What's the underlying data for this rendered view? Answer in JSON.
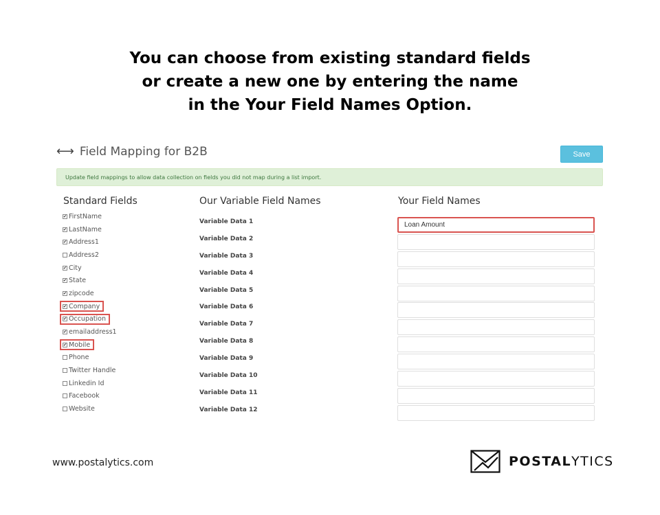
{
  "headline": {
    "line1": "You can choose from existing standard fields",
    "line2": "or create a new one by entering the name",
    "line3": "in the Your Field Names Option."
  },
  "panel": {
    "title": "Field Mapping for B2B",
    "save_label": "Save",
    "alert_text": "Update field mappings to allow data collection on fields you did not map during a list import."
  },
  "columns": {
    "standard": "Standard Fields",
    "variable": "Our Variable Field Names",
    "yours": "Your Field Names"
  },
  "standard_fields": [
    {
      "label": "FirstName",
      "checked": true,
      "highlight": false
    },
    {
      "label": "LastName",
      "checked": true,
      "highlight": false
    },
    {
      "label": "Address1",
      "checked": true,
      "highlight": false
    },
    {
      "label": "Address2",
      "checked": false,
      "highlight": false
    },
    {
      "label": "City",
      "checked": true,
      "highlight": false
    },
    {
      "label": "State",
      "checked": true,
      "highlight": false
    },
    {
      "label": "zipcode",
      "checked": true,
      "highlight": false
    },
    {
      "label": "Company",
      "checked": true,
      "highlight": true
    },
    {
      "label": "Occupation",
      "checked": true,
      "highlight": true
    },
    {
      "label": "emailaddress1",
      "checked": true,
      "highlight": false
    },
    {
      "label": "Mobile",
      "checked": true,
      "highlight": true
    },
    {
      "label": "Phone",
      "checked": false,
      "highlight": false
    },
    {
      "label": "Twitter Handle",
      "checked": false,
      "highlight": false
    },
    {
      "label": "Linkedin Id",
      "checked": false,
      "highlight": false
    },
    {
      "label": "Facebook",
      "checked": false,
      "highlight": false
    },
    {
      "label": "Website",
      "checked": false,
      "highlight": false
    }
  ],
  "variable_fields": [
    "Variable Data 1",
    "Variable Data 2",
    "Variable Data 3",
    "Variable Data 4",
    "Variable Data 5",
    "Variable Data 6",
    "Variable Data 7",
    "Variable Data 8",
    "Variable Data 9",
    "Variable Data 10",
    "Variable Data 11",
    "Variable Data 12"
  ],
  "your_fields": [
    {
      "value": "Loan Amount",
      "highlight": true
    },
    {
      "value": "",
      "highlight": false
    },
    {
      "value": "",
      "highlight": false
    },
    {
      "value": "",
      "highlight": false
    },
    {
      "value": "",
      "highlight": false
    },
    {
      "value": "",
      "highlight": false
    },
    {
      "value": "",
      "highlight": false
    },
    {
      "value": "",
      "highlight": false
    },
    {
      "value": "",
      "highlight": false
    },
    {
      "value": "",
      "highlight": false
    },
    {
      "value": "",
      "highlight": false
    },
    {
      "value": "",
      "highlight": false
    }
  ],
  "footer": {
    "url": "www.postalytics.com",
    "brand_bold": "POSTAL",
    "brand_light": "YTICS"
  },
  "colors": {
    "accent": "#5bc0de",
    "highlight": "#d9534f",
    "alert_bg": "#dff0d8"
  },
  "icons": {
    "title": "left-right-arrow-icon",
    "logo": "envelope-icon"
  }
}
